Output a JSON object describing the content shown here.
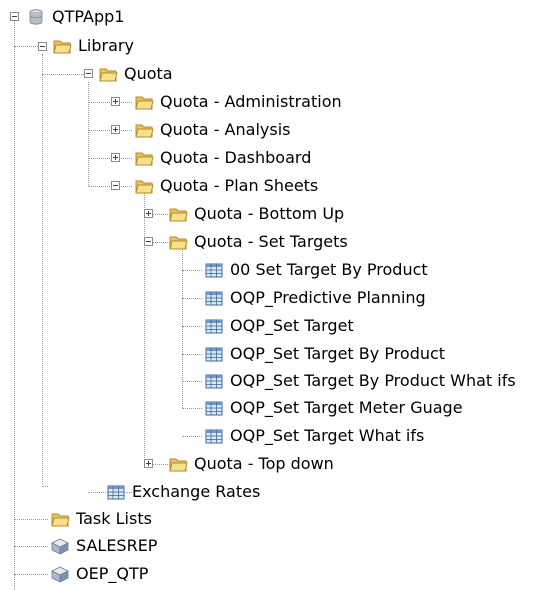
{
  "tree": {
    "root": {
      "label": "QTPApp1",
      "icon": "database-icon"
    },
    "library": {
      "label": "Library",
      "icon": "folder-icon"
    },
    "quota": {
      "label": "Quota",
      "icon": "folder-icon"
    },
    "quota_children": [
      {
        "label": "Quota - Administration",
        "icon": "folder-icon"
      },
      {
        "label": "Quota - Analysis",
        "icon": "folder-icon"
      },
      {
        "label": "Quota - Dashboard",
        "icon": "folder-icon"
      },
      {
        "label": "Quota - Plan Sheets",
        "icon": "folder-icon"
      }
    ],
    "plan_children": [
      {
        "label": "Quota - Bottom Up",
        "icon": "folder-icon"
      },
      {
        "label": "Quota - Set Targets",
        "icon": "folder-icon"
      }
    ],
    "forms": [
      {
        "label": "00 Set Target By Product",
        "icon": "form-grid-icon"
      },
      {
        "label": "OQP_Predictive Planning",
        "icon": "form-grid-icon"
      },
      {
        "label": "OQP_Set Target",
        "icon": "form-grid-icon"
      },
      {
        "label": "OQP_Set Target By Product",
        "icon": "form-grid-icon"
      },
      {
        "label": "OQP_Set Target By Product What ifs",
        "icon": "form-grid-icon"
      },
      {
        "label": "OQP_Set Target Meter Guage",
        "icon": "form-grid-icon"
      },
      {
        "label": "OQP_Set Target What ifs",
        "icon": "form-grid-icon"
      }
    ],
    "top_down": {
      "label": "Quota - Top down",
      "icon": "folder-icon"
    },
    "exchange_rates": {
      "label": "Exchange Rates",
      "icon": "form-grid-icon"
    },
    "task_lists": {
      "label": "Task Lists",
      "icon": "folder-icon"
    },
    "salesrep": {
      "label": "SALESREP",
      "icon": "cube-icon"
    },
    "oep_qtp": {
      "label": "OEP_QTP",
      "icon": "cube-icon"
    }
  },
  "colors": {
    "folder_fill": "#f7e08a",
    "folder_stroke": "#c9a53a",
    "grid_fill": "#8fb3d9",
    "grid_stroke": "#3f6a9c",
    "connector": "#9a9a9a"
  }
}
